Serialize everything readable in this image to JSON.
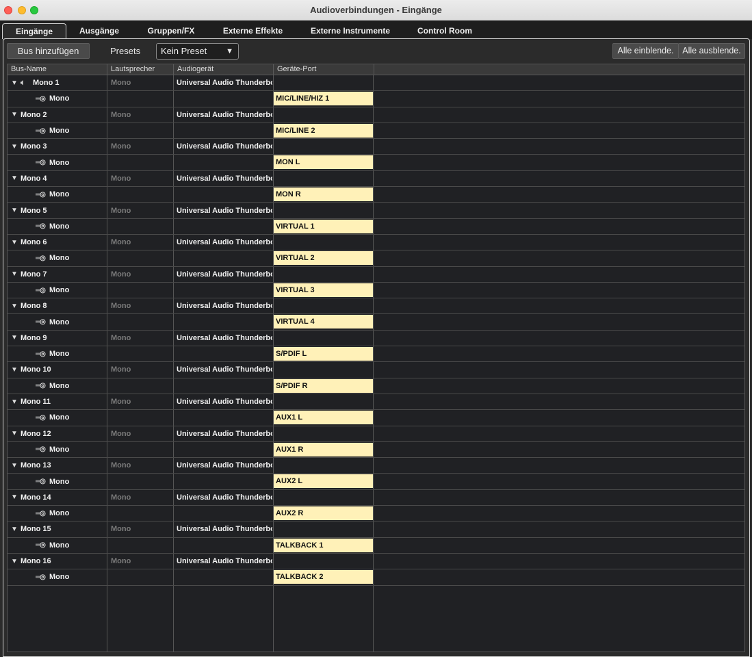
{
  "window": {
    "title": "Audioverbindungen - Eingänge"
  },
  "tabs": [
    {
      "label": "Eingänge",
      "active": true
    },
    {
      "label": "Ausgänge",
      "active": false
    },
    {
      "label": "Gruppen/FX",
      "active": false
    },
    {
      "label": "Externe Effekte",
      "active": false
    },
    {
      "label": "Externe Instrumente",
      "active": false
    },
    {
      "label": "Control Room",
      "active": false
    }
  ],
  "toolbar": {
    "add_bus_label": "Bus hinzufügen",
    "presets_label": "Presets",
    "preset_value": "Kein Preset",
    "show_all_label": "Alle einblende.",
    "hide_all_label": "Alle ausblende."
  },
  "table": {
    "columns": [
      "Bus-Name",
      "Lautsprecher",
      "Audiogerät",
      "Geräte-Port"
    ],
    "buses": [
      {
        "name": "Mono 1",
        "speaker": "Mono",
        "device": "Universal Audio Thunderbol",
        "channel": "Mono",
        "port": "MIC/LINE/HIZ 1",
        "monitor": true
      },
      {
        "name": "Mono 2",
        "speaker": "Mono",
        "device": "Universal Audio Thunderbol",
        "channel": "Mono",
        "port": "MIC/LINE 2"
      },
      {
        "name": "Mono 3",
        "speaker": "Mono",
        "device": "Universal Audio Thunderbol",
        "channel": "Mono",
        "port": "MON L"
      },
      {
        "name": "Mono 4",
        "speaker": "Mono",
        "device": "Universal Audio Thunderbol",
        "channel": "Mono",
        "port": "MON R"
      },
      {
        "name": "Mono 5",
        "speaker": "Mono",
        "device": "Universal Audio Thunderbol",
        "channel": "Mono",
        "port": "VIRTUAL 1"
      },
      {
        "name": "Mono 6",
        "speaker": "Mono",
        "device": "Universal Audio Thunderbol",
        "channel": "Mono",
        "port": "VIRTUAL 2"
      },
      {
        "name": "Mono 7",
        "speaker": "Mono",
        "device": "Universal Audio Thunderbol",
        "channel": "Mono",
        "port": "VIRTUAL 3"
      },
      {
        "name": "Mono 8",
        "speaker": "Mono",
        "device": "Universal Audio Thunderbol",
        "channel": "Mono",
        "port": "VIRTUAL 4"
      },
      {
        "name": "Mono 9",
        "speaker": "Mono",
        "device": "Universal Audio Thunderbol",
        "channel": "Mono",
        "port": "S/PDIF L"
      },
      {
        "name": "Mono 10",
        "speaker": "Mono",
        "device": "Universal Audio Thunderbol",
        "channel": "Mono",
        "port": "S/PDIF R"
      },
      {
        "name": "Mono 11",
        "speaker": "Mono",
        "device": "Universal Audio Thunderbol",
        "channel": "Mono",
        "port": "AUX1 L"
      },
      {
        "name": "Mono 12",
        "speaker": "Mono",
        "device": "Universal Audio Thunderbol",
        "channel": "Mono",
        "port": "AUX1 R"
      },
      {
        "name": "Mono 13",
        "speaker": "Mono",
        "device": "Universal Audio Thunderbol",
        "channel": "Mono",
        "port": "AUX2 L"
      },
      {
        "name": "Mono 14",
        "speaker": "Mono",
        "device": "Universal Audio Thunderbol",
        "channel": "Mono",
        "port": "AUX2 R"
      },
      {
        "name": "Mono 15",
        "speaker": "Mono",
        "device": "Universal Audio Thunderbol",
        "channel": "Mono",
        "port": "TALKBACK 1"
      },
      {
        "name": "Mono 16",
        "speaker": "Mono",
        "device": "Universal Audio Thunderbol",
        "channel": "Mono",
        "port": "TALKBACK 2"
      }
    ]
  }
}
